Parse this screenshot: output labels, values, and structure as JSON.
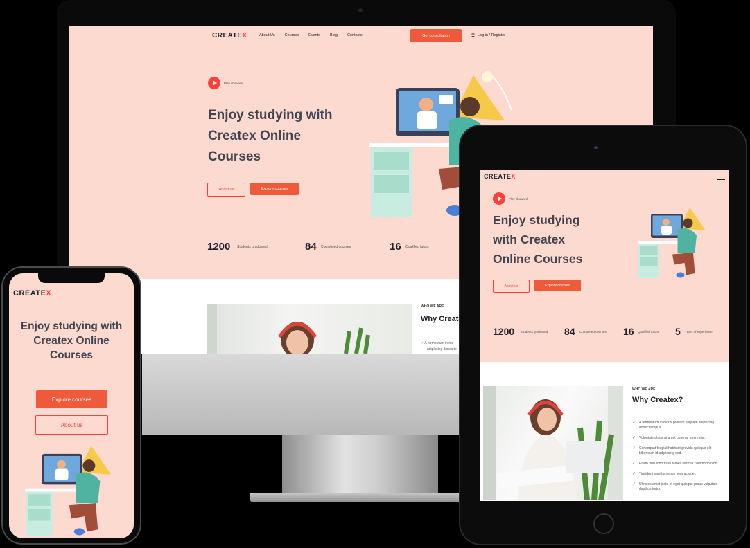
{
  "brand": {
    "logo_main": "CREATE",
    "logo_x": "X",
    "accent": "#ff3f3a",
    "button_color": "#ee5a3a",
    "hero_bg": "#fddad0"
  },
  "nav": {
    "links": [
      "About Us",
      "Courses",
      "Events",
      "Blog",
      "Contacts"
    ],
    "cta": "Get consultation",
    "login": "Log in / Register"
  },
  "hero": {
    "play_label": "Play showreel",
    "title": "Enjoy studying with Createx Online Courses",
    "tablet_title": "Enjoy studying with Createx Online Courses",
    "phone_title": "Enjoy studying with Createx Online Courses",
    "about_button": "About us",
    "explore_button": "Explore courses"
  },
  "stats": [
    {
      "value": "1200",
      "label": "Students graduated"
    },
    {
      "value": "84",
      "label": "Completed courses"
    },
    {
      "value": "16",
      "label": "Qualified tutors"
    },
    {
      "value": "5",
      "label": "Years of experience"
    }
  ],
  "about": {
    "eyebrow": "WHO WE ARE",
    "heading": "Why Createx?",
    "desktop_heading": "Why Create",
    "desktop_item_1": "A fermentum in mo",
    "desktop_item_2": "adipiscing donec te",
    "items": [
      "A fermentum in morbi pretium aliquam adipiscing donec tempus.",
      "Vulputate placerat amet pulvinar lorem nisl.",
      "Consequat feugiat habitant gravida quisque elit bibendum id adipiscing sed.",
      "Etiam duis lobortis in fames ultrices commodo nibh.",
      "Tincidunt sagittis neque sem ac eget.",
      "Ultricies amet justo et eget quisque purus vulputate dapibus tortor."
    ]
  },
  "icons": [
    "play-icon",
    "user-icon",
    "menu-icon",
    "check-icon",
    "apple-logo-icon"
  ]
}
